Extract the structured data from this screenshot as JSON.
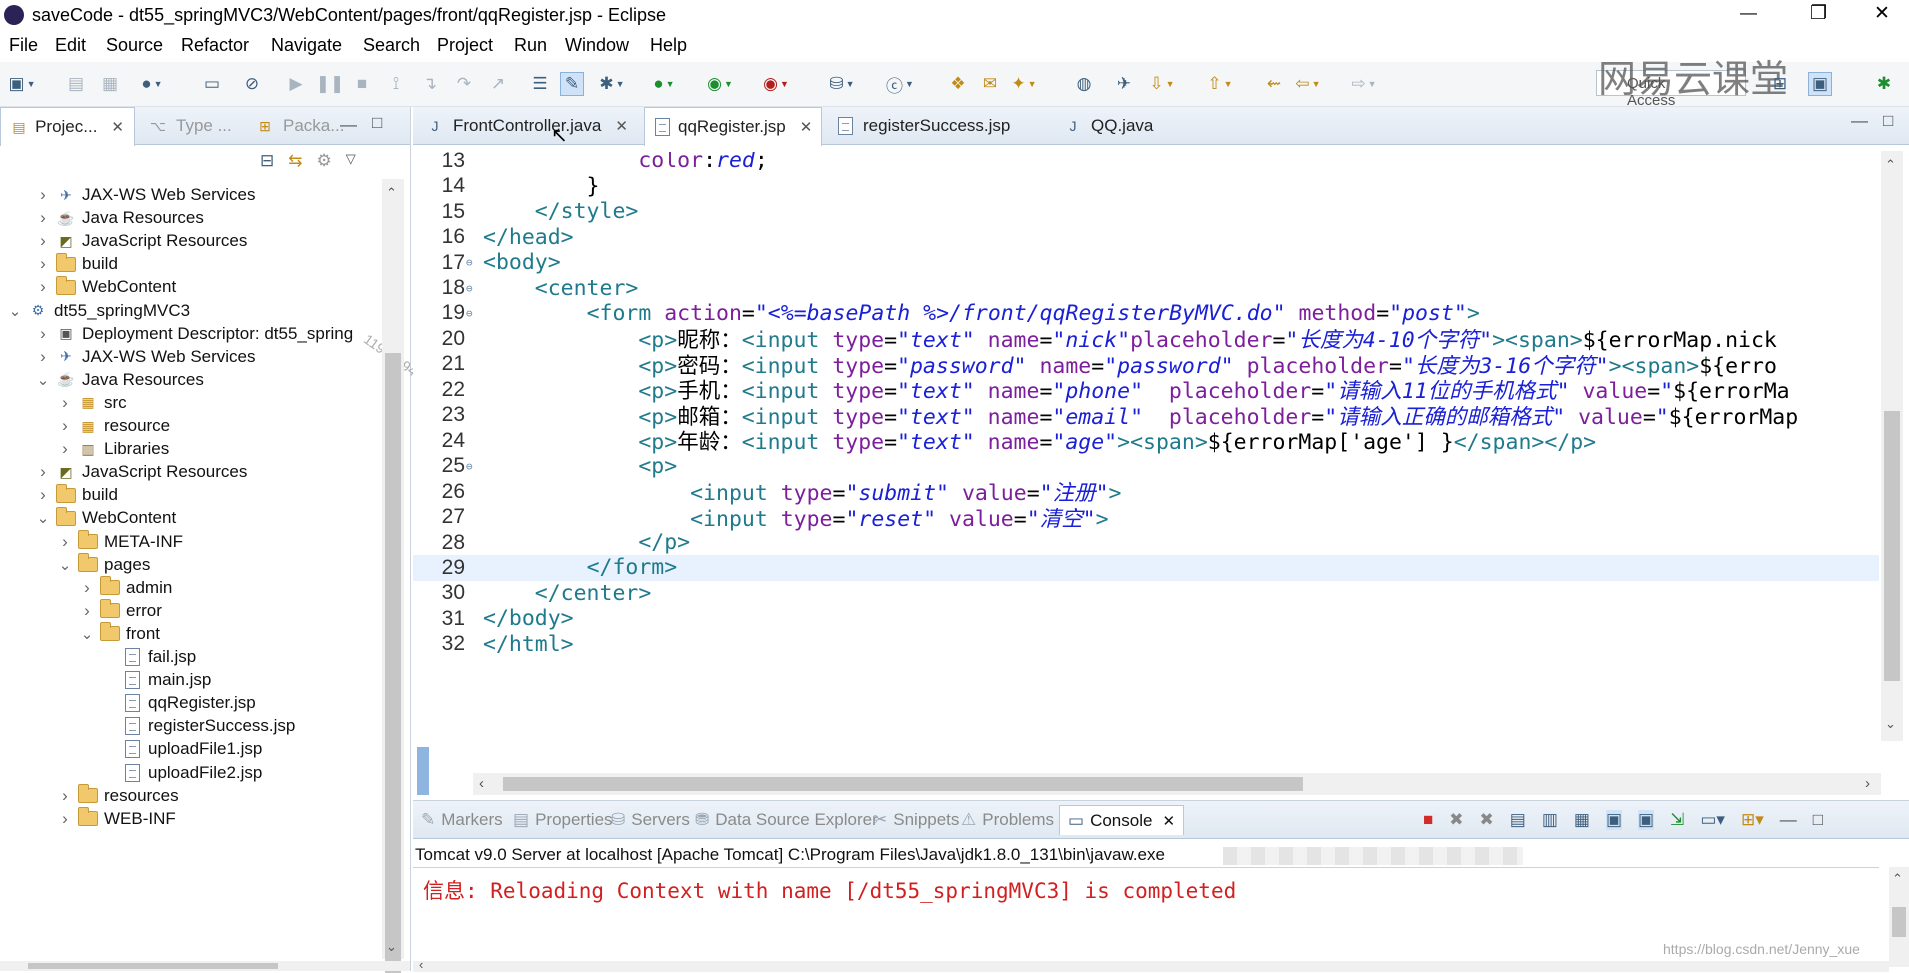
{
  "window": {
    "title": "saveCode - dt55_springMVC3/WebContent/pages/front/qqRegister.jsp - Eclipse",
    "controls": {
      "minimize": "—",
      "restore": "❐",
      "close": "✕"
    }
  },
  "menu": [
    "File",
    "Edit",
    "Source",
    "Refactor",
    "Navigate",
    "Search",
    "Project",
    "Run",
    "Window",
    "Help"
  ],
  "toolbar": {
    "quick_access_placeholder": "Quick Access"
  },
  "watermark": {
    "brand": "网易云课堂",
    "url": "https://blog.csdn.net/Jenny_xue"
  },
  "left_panel": {
    "tabs": [
      {
        "label": "Projec...",
        "close": "✕"
      },
      {
        "label": "Type ..."
      },
      {
        "label": "Packa..."
      }
    ],
    "tree": [
      {
        "label": "JAX-WS Web Services",
        "depth": 1,
        "icon": "webservice-icon",
        "expanded": false
      },
      {
        "label": "Java Resources",
        "depth": 1,
        "icon": "java-resources-icon",
        "expanded": false
      },
      {
        "label": "JavaScript Resources",
        "depth": 1,
        "icon": "javascript-resources-icon",
        "expanded": false
      },
      {
        "label": "build",
        "depth": 1,
        "icon": "folder-icon",
        "expanded": false
      },
      {
        "label": "WebContent",
        "depth": 1,
        "icon": "folder-icon",
        "expanded": false
      },
      {
        "label": "dt55_springMVC3",
        "depth": 0,
        "icon": "project-icon",
        "expanded": true
      },
      {
        "label": "Deployment Descriptor: dt55_spring",
        "depth": 1,
        "icon": "descriptor-icon",
        "expanded": false
      },
      {
        "label": "JAX-WS Web Services",
        "depth": 1,
        "icon": "webservice-icon",
        "expanded": false
      },
      {
        "label": "Java Resources",
        "depth": 1,
        "icon": "java-resources-icon",
        "expanded": true
      },
      {
        "label": "src",
        "depth": 2,
        "icon": "source-folder-icon",
        "expanded": false
      },
      {
        "label": "resource",
        "depth": 2,
        "icon": "source-folder-icon",
        "expanded": false
      },
      {
        "label": "Libraries",
        "depth": 2,
        "icon": "libraries-icon",
        "expanded": false
      },
      {
        "label": "JavaScript Resources",
        "depth": 1,
        "icon": "javascript-resources-icon",
        "expanded": false
      },
      {
        "label": "build",
        "depth": 1,
        "icon": "folder-icon",
        "expanded": false
      },
      {
        "label": "WebContent",
        "depth": 1,
        "icon": "folder-icon",
        "expanded": true
      },
      {
        "label": "META-INF",
        "depth": 2,
        "icon": "folder-icon",
        "expanded": false
      },
      {
        "label": "pages",
        "depth": 2,
        "icon": "folder-icon",
        "expanded": true
      },
      {
        "label": "admin",
        "depth": 3,
        "icon": "folder-icon",
        "expanded": false
      },
      {
        "label": "error",
        "depth": 3,
        "icon": "folder-icon",
        "expanded": false
      },
      {
        "label": "front",
        "depth": 3,
        "icon": "folder-icon",
        "expanded": true
      },
      {
        "label": "fail.jsp",
        "depth": 4,
        "icon": "jsp-file-icon"
      },
      {
        "label": "main.jsp",
        "depth": 4,
        "icon": "jsp-file-icon"
      },
      {
        "label": "qqRegister.jsp",
        "depth": 4,
        "icon": "jsp-file-icon"
      },
      {
        "label": "registerSuccess.jsp",
        "depth": 4,
        "icon": "jsp-file-icon"
      },
      {
        "label": "uploadFile1.jsp",
        "depth": 4,
        "icon": "jsp-file-icon"
      },
      {
        "label": "uploadFile2.jsp",
        "depth": 4,
        "icon": "jsp-file-icon"
      },
      {
        "label": "resources",
        "depth": 2,
        "icon": "folder-icon",
        "expanded": false
      },
      {
        "label": "WEB-INF",
        "depth": 2,
        "icon": "folder-icon",
        "expanded": false
      }
    ],
    "overlay_text": "11931394"
  },
  "editor": {
    "tabs": [
      {
        "label": "FrontController.java",
        "active": false,
        "close": "✕"
      },
      {
        "label": "qqRegister.jsp",
        "active": true,
        "close": "✕"
      },
      {
        "label": "registerSuccess.jsp",
        "active": false
      },
      {
        "label": "QQ.java",
        "active": false
      }
    ],
    "lines": [
      {
        "n": "13",
        "tokens": [
          [
            "p",
            "            "
          ],
          [
            "a",
            "color"
          ],
          [
            "p",
            ":"
          ],
          [
            "s",
            "red"
          ],
          [
            "p",
            ";"
          ]
        ]
      },
      {
        "n": "14",
        "tokens": [
          [
            "p",
            "        }"
          ]
        ]
      },
      {
        "n": "15",
        "tokens": [
          [
            "p",
            "    "
          ],
          [
            "t",
            "</style>"
          ]
        ]
      },
      {
        "n": "16",
        "tokens": [
          [
            "t",
            "</head>"
          ]
        ]
      },
      {
        "n": "17",
        "fold": "⊖",
        "tokens": [
          [
            "t",
            "<body>"
          ]
        ]
      },
      {
        "n": "18",
        "fold": "⊖",
        "tokens": [
          [
            "p",
            "    "
          ],
          [
            "t",
            "<center>"
          ]
        ]
      },
      {
        "n": "19",
        "fold": "⊖",
        "tokens": [
          [
            "p",
            "        "
          ],
          [
            "t",
            "<form "
          ],
          [
            "a",
            "action"
          ],
          [
            "p",
            "="
          ],
          [
            "s",
            "\"<%=basePath %>/front/qqRegisterByMVC.do\""
          ],
          [
            "p",
            " "
          ],
          [
            "a",
            "method"
          ],
          [
            "p",
            "="
          ],
          [
            "s",
            "\"post\""
          ],
          [
            "t",
            ">"
          ]
        ]
      },
      {
        "n": "20",
        "tokens": [
          [
            "p",
            "            "
          ],
          [
            "t",
            "<p>"
          ],
          [
            "p",
            "昵称："
          ],
          [
            "t",
            "<input "
          ],
          [
            "a",
            "type"
          ],
          [
            "p",
            "="
          ],
          [
            "s",
            "\"text\""
          ],
          [
            "p",
            " "
          ],
          [
            "a",
            "name"
          ],
          [
            "p",
            "="
          ],
          [
            "s",
            "\"nick\""
          ],
          [
            "a",
            "placeholder"
          ],
          [
            "p",
            "="
          ],
          [
            "s",
            "\"长度为4-10个字符\""
          ],
          [
            "t",
            ">"
          ],
          [
            "t",
            "<span>"
          ],
          [
            "p",
            "${errorMap.nick"
          ]
        ]
      },
      {
        "n": "21",
        "tokens": [
          [
            "p",
            "            "
          ],
          [
            "t",
            "<p>"
          ],
          [
            "p",
            "密码："
          ],
          [
            "t",
            "<input "
          ],
          [
            "a",
            "type"
          ],
          [
            "p",
            "="
          ],
          [
            "s",
            "\"password\""
          ],
          [
            "p",
            " "
          ],
          [
            "a",
            "name"
          ],
          [
            "p",
            "="
          ],
          [
            "s",
            "\"password\""
          ],
          [
            "p",
            " "
          ],
          [
            "a",
            "placeholder"
          ],
          [
            "p",
            "="
          ],
          [
            "s",
            "\"长度为3-16个字符\""
          ],
          [
            "t",
            ">"
          ],
          [
            "t",
            "<span>"
          ],
          [
            "p",
            "${erro"
          ]
        ]
      },
      {
        "n": "22",
        "tokens": [
          [
            "p",
            "            "
          ],
          [
            "t",
            "<p>"
          ],
          [
            "p",
            "手机："
          ],
          [
            "t",
            "<input "
          ],
          [
            "a",
            "type"
          ],
          [
            "p",
            "="
          ],
          [
            "s",
            "\"text\""
          ],
          [
            "p",
            " "
          ],
          [
            "a",
            "name"
          ],
          [
            "p",
            "="
          ],
          [
            "s",
            "\"phone\""
          ],
          [
            "p",
            "  "
          ],
          [
            "a",
            "placeholder"
          ],
          [
            "p",
            "="
          ],
          [
            "s",
            "\"请输入11位的手机格式\""
          ],
          [
            "p",
            " "
          ],
          [
            "a",
            "value"
          ],
          [
            "p",
            "="
          ],
          [
            "s",
            "\""
          ],
          [
            "p",
            "${errorMa"
          ]
        ]
      },
      {
        "n": "23",
        "tokens": [
          [
            "p",
            "            "
          ],
          [
            "t",
            "<p>"
          ],
          [
            "p",
            "邮箱："
          ],
          [
            "t",
            "<input "
          ],
          [
            "a",
            "type"
          ],
          [
            "p",
            "="
          ],
          [
            "s",
            "\"text\""
          ],
          [
            "p",
            " "
          ],
          [
            "a",
            "name"
          ],
          [
            "p",
            "="
          ],
          [
            "s",
            "\"email\""
          ],
          [
            "p",
            "  "
          ],
          [
            "a",
            "placeholder"
          ],
          [
            "p",
            "="
          ],
          [
            "s",
            "\"请输入正确的邮箱格式\""
          ],
          [
            "p",
            " "
          ],
          [
            "a",
            "value"
          ],
          [
            "p",
            "="
          ],
          [
            "s",
            "\""
          ],
          [
            "p",
            "${errorMap"
          ]
        ]
      },
      {
        "n": "24",
        "tokens": [
          [
            "p",
            "            "
          ],
          [
            "t",
            "<p>"
          ],
          [
            "p",
            "年龄："
          ],
          [
            "t",
            "<input "
          ],
          [
            "a",
            "type"
          ],
          [
            "p",
            "="
          ],
          [
            "s",
            "\"text\""
          ],
          [
            "p",
            " "
          ],
          [
            "a",
            "name"
          ],
          [
            "p",
            "="
          ],
          [
            "s",
            "\"age\""
          ],
          [
            "t",
            ">"
          ],
          [
            "t",
            "<span>"
          ],
          [
            "p",
            "${errorMap['age'] }"
          ],
          [
            "t",
            "</span></p>"
          ]
        ]
      },
      {
        "n": "25",
        "fold": "⊖",
        "tokens": [
          [
            "p",
            "            "
          ],
          [
            "t",
            "<p>"
          ]
        ]
      },
      {
        "n": "26",
        "tokens": [
          [
            "p",
            "                "
          ],
          [
            "t",
            "<input "
          ],
          [
            "a",
            "type"
          ],
          [
            "p",
            "="
          ],
          [
            "s",
            "\"submit\""
          ],
          [
            "p",
            " "
          ],
          [
            "a",
            "value"
          ],
          [
            "p",
            "="
          ],
          [
            "s",
            "\"注册\""
          ],
          [
            "t",
            ">"
          ]
        ]
      },
      {
        "n": "27",
        "tokens": [
          [
            "p",
            "                "
          ],
          [
            "t",
            "<input "
          ],
          [
            "a",
            "type"
          ],
          [
            "p",
            "="
          ],
          [
            "s",
            "\"reset\""
          ],
          [
            "p",
            " "
          ],
          [
            "a",
            "value"
          ],
          [
            "p",
            "="
          ],
          [
            "s",
            "\"清空\""
          ],
          [
            "t",
            ">"
          ]
        ]
      },
      {
        "n": "28",
        "tokens": [
          [
            "p",
            "            "
          ],
          [
            "t",
            "</p>"
          ]
        ]
      },
      {
        "n": "29",
        "highlight": true,
        "tokens": [
          [
            "p",
            "        "
          ],
          [
            "t",
            "</form>"
          ]
        ]
      },
      {
        "n": "30",
        "tokens": [
          [
            "p",
            "    "
          ],
          [
            "t",
            "</center>"
          ]
        ]
      },
      {
        "n": "31",
        "tokens": [
          [
            "t",
            "</body>"
          ]
        ]
      },
      {
        "n": "32",
        "tokens": [
          [
            "t",
            "</html>"
          ]
        ]
      }
    ]
  },
  "bottom_panel": {
    "tabs": [
      {
        "label": "Markers"
      },
      {
        "label": "Properties"
      },
      {
        "label": "Servers"
      },
      {
        "label": "Data Source Explorer"
      },
      {
        "label": "Snippets"
      },
      {
        "label": "Problems"
      },
      {
        "label": "Console",
        "active": true,
        "close": "✕"
      }
    ],
    "console_header": "Tomcat v9.0 Server at localhost [Apache Tomcat] C:\\Program Files\\Java\\jdk1.8.0_131\\bin\\javaw.exe",
    "console_output": "信息: Reloading Context with name [/dt55_springMVC3] is completed"
  },
  "colors": {
    "tag": "#1f7a8c",
    "attr": "#7d1f9c",
    "string": "#1a20d6",
    "console_info": "#d21f1f"
  }
}
